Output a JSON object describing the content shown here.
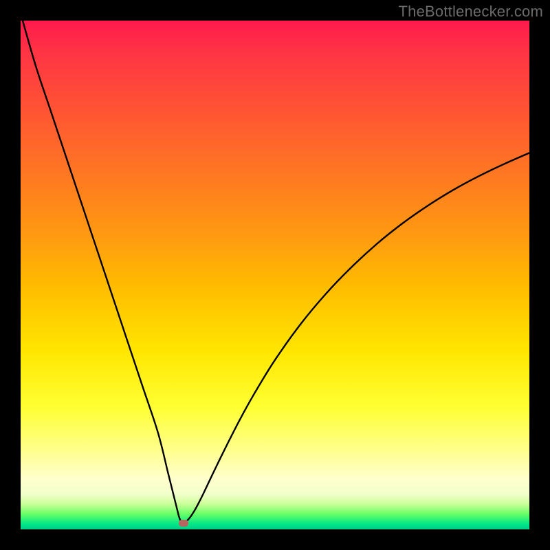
{
  "watermark": "TheBottlenecker.com",
  "colors": {
    "frame": "#000000",
    "curve": "#000000",
    "marker": "#b6675f"
  },
  "chart_data": {
    "type": "line",
    "title": "",
    "xlabel": "",
    "ylabel": "",
    "xlim": [
      0,
      100
    ],
    "ylim": [
      0,
      100
    ],
    "grid": false,
    "series": [
      {
        "name": "bottleneck-curve",
        "x": [
          0.4,
          3,
          6,
          9,
          12,
          15,
          18,
          21,
          24,
          27,
          29,
          30.5,
          31.3,
          32,
          33,
          34,
          35,
          36,
          38,
          40,
          43,
          46,
          50,
          55,
          60,
          65,
          70,
          75,
          80,
          85,
          90,
          95,
          100
        ],
        "y": [
          100,
          91,
          82,
          73,
          64,
          55,
          46,
          37,
          28,
          19,
          11,
          5,
          2,
          1.2,
          2,
          3.4,
          5.2,
          7.2,
          11.4,
          15.5,
          21.4,
          26.8,
          33.3,
          40.3,
          46.3,
          51.5,
          56.1,
          60.1,
          63.6,
          66.7,
          69.4,
          71.8,
          74
        ]
      }
    ],
    "annotations": [
      {
        "name": "optimal-marker",
        "x": 32,
        "y": 1.2
      }
    ],
    "gradient_stops": [
      {
        "pos": 0,
        "color": "#ff1a4d"
      },
      {
        "pos": 50,
        "color": "#ffcc00"
      },
      {
        "pos": 80,
        "color": "#ffff66"
      },
      {
        "pos": 100,
        "color": "#00cc88"
      }
    ]
  }
}
